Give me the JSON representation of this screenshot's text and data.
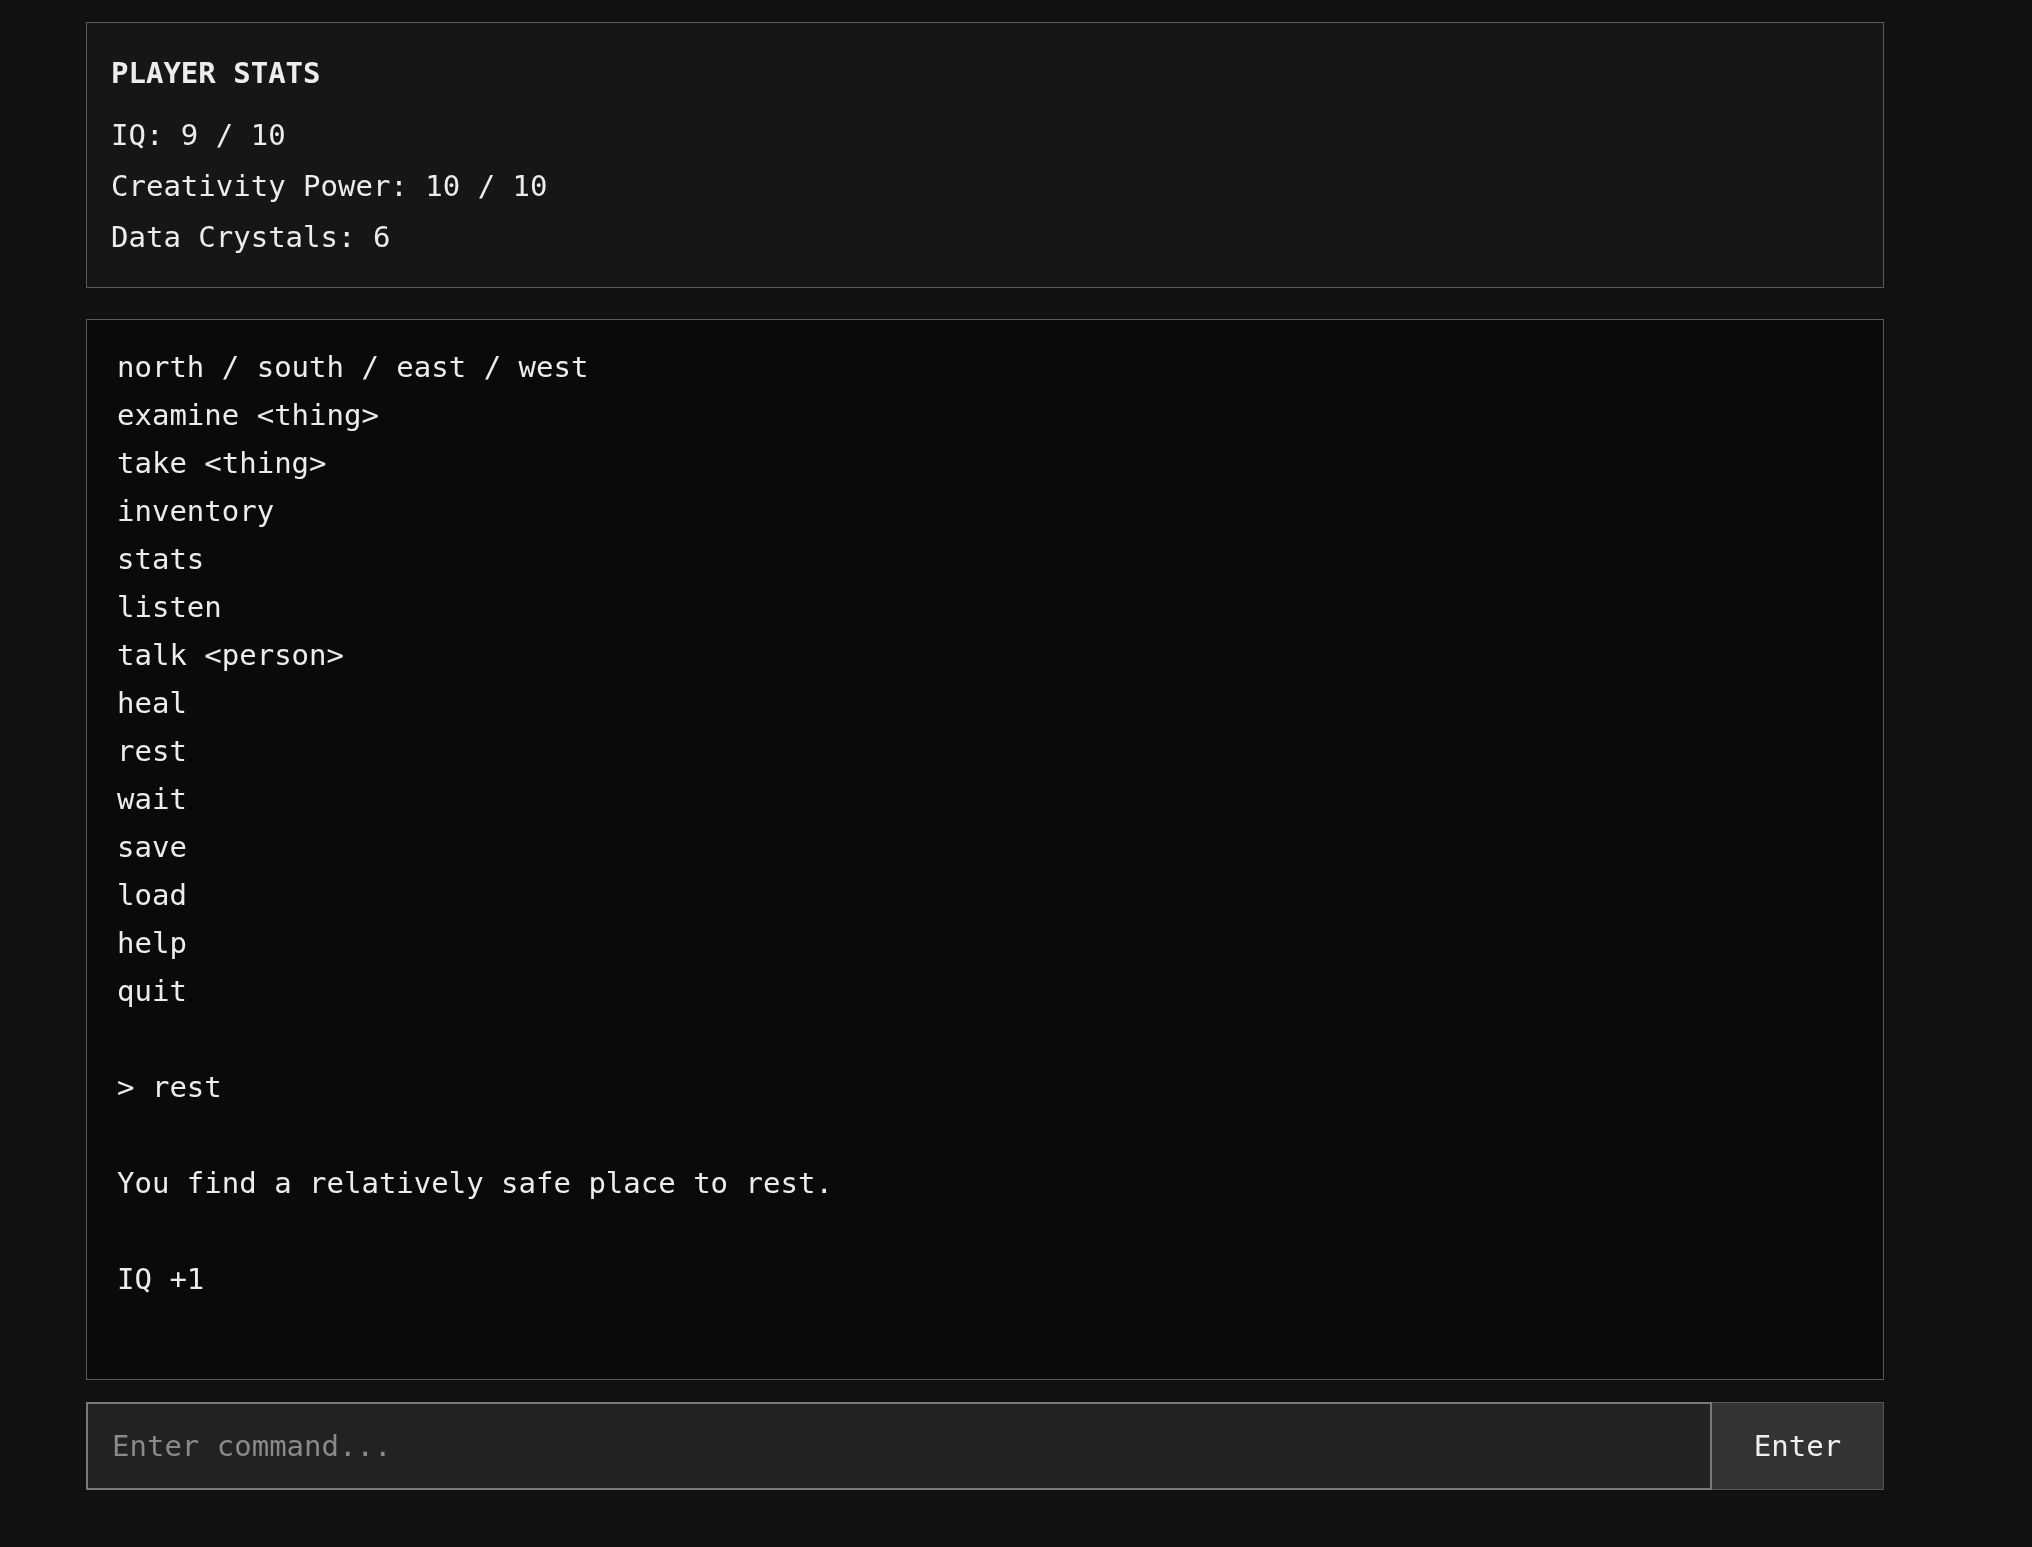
{
  "stats_panel": {
    "title": "PLAYER STATS",
    "lines": [
      "IQ: 9 / 10",
      "Creativity Power: 10 / 10",
      "Data Crystals: 6"
    ]
  },
  "terminal": {
    "blocks": [
      {
        "lines": [
          "north / south / east / west",
          "examine <thing>",
          "take <thing>",
          "inventory",
          "stats",
          "listen",
          "talk <person>",
          "heal",
          "rest",
          "wait",
          "save",
          "load",
          "help",
          "quit"
        ]
      },
      {
        "lines": [
          "> rest"
        ]
      },
      {
        "lines": [
          "You find a relatively safe place to rest."
        ]
      },
      {
        "lines": [
          "IQ +1"
        ]
      }
    ]
  },
  "command_bar": {
    "input": {
      "placeholder": "Enter command..."
    },
    "button": "Enter"
  }
}
